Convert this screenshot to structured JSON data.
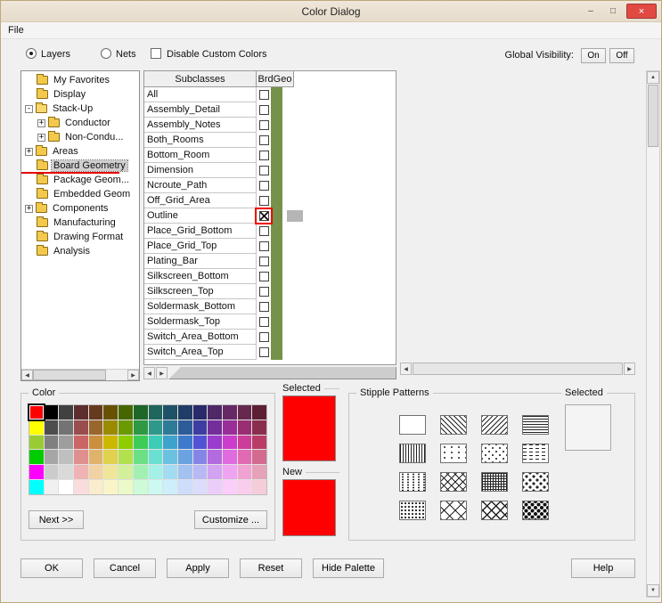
{
  "window": {
    "title": "Color Dialog"
  },
  "icons": {
    "minimize": "–",
    "maximize": "□",
    "close": "×",
    "arrow_up": "▲",
    "arrow_down": "▼",
    "arrow_left": "◀",
    "arrow_right": "▶",
    "expand": "+",
    "collapse": "-"
  },
  "menu": {
    "items": [
      "File"
    ]
  },
  "filter_bar": {
    "layers": "Layers",
    "nets": "Nets",
    "layers_selected": true,
    "disable_custom_colors": "Disable Custom Colors",
    "disable_checked": false,
    "global_visibility_label": "Global Visibility:",
    "on": "On",
    "off": "Off"
  },
  "tree": {
    "items": [
      {
        "label": "My Favorites",
        "level": 0,
        "expander": null
      },
      {
        "label": "Display",
        "level": 0,
        "expander": null
      },
      {
        "label": "Stack-Up",
        "level": 0,
        "expander": "minus",
        "open": true
      },
      {
        "label": "Conductor",
        "level": 1,
        "expander": "plus"
      },
      {
        "label": "Non-Condu...",
        "level": 1,
        "expander": "plus"
      },
      {
        "label": "Areas",
        "level": 0,
        "expander": "plus"
      },
      {
        "label": "Board Geometry",
        "level": 0,
        "expander": null,
        "selected": true,
        "annotated": true
      },
      {
        "label": "Package Geom...",
        "level": 0,
        "expander": null
      },
      {
        "label": "Embedded Geom",
        "level": 0,
        "expander": null
      },
      {
        "label": "Components",
        "level": 0,
        "expander": "plus"
      },
      {
        "label": "Manufacturing",
        "level": 0,
        "expander": null
      },
      {
        "label": "Drawing Format",
        "level": 0,
        "expander": null
      },
      {
        "label": "Analysis",
        "level": 0,
        "expander": null
      }
    ]
  },
  "subclass_table": {
    "headers": [
      "Subclasses",
      "BrdGeo"
    ],
    "layer_color": "#76914a",
    "rows": [
      {
        "label": "All",
        "checked": false
      },
      {
        "label": "Assembly_Detail",
        "checked": false
      },
      {
        "label": "Assembly_Notes",
        "checked": false
      },
      {
        "label": "Both_Rooms",
        "checked": false
      },
      {
        "label": "Bottom_Room",
        "checked": false
      },
      {
        "label": "Dimension",
        "checked": false
      },
      {
        "label": "Ncroute_Path",
        "checked": false
      },
      {
        "label": "Off_Grid_Area",
        "checked": false
      },
      {
        "label": "Outline",
        "checked": true,
        "annotated": true,
        "marker": true
      },
      {
        "label": "Place_Grid_Bottom",
        "checked": false
      },
      {
        "label": "Place_Grid_Top",
        "checked": false
      },
      {
        "label": "Plating_Bar",
        "checked": false
      },
      {
        "label": "Silkscreen_Bottom",
        "checked": false
      },
      {
        "label": "Silkscreen_Top",
        "checked": false
      },
      {
        "label": "Soldermask_Bottom",
        "checked": false
      },
      {
        "label": "Soldermask_Top",
        "checked": false
      },
      {
        "label": "Switch_Area_Bottom",
        "checked": false
      },
      {
        "label": "Switch_Area_Top",
        "checked": false
      }
    ]
  },
  "color_section": {
    "legend": "Color",
    "next_label": "Next >>",
    "customize_label": "Customize ...",
    "selected_index": 0,
    "palette": [
      [
        "#ff0000",
        "#000000",
        "#404040",
        "#5c2e2e",
        "#663a1f",
        "#665200",
        "#466600",
        "#1f6629",
        "#1f665c",
        "#1f5266",
        "#1f3d66",
        "#29296b",
        "#4d2966",
        "#662966",
        "#66294d",
        "#5c1f33"
      ],
      [
        "#ffff00",
        "#4d4d4d",
        "#737373",
        "#994d4d",
        "#99662e",
        "#998a00",
        "#6b9900",
        "#2e9942",
        "#2e998a",
        "#2e7a99",
        "#2e5c99",
        "#3d3da1",
        "#732e99",
        "#992e99",
        "#992e73",
        "#8a2e4d"
      ],
      [
        "#99cc33",
        "#808080",
        "#9e9e9e",
        "#cc6666",
        "#cc8f3d",
        "#ccb800",
        "#8fcc00",
        "#3dcc58",
        "#3dccb8",
        "#3da3cc",
        "#3d7acc",
        "#5252d6",
        "#993dcc",
        "#cc3dcc",
        "#cc3d99",
        "#b83d66"
      ],
      [
        "#00cc00",
        "#a6a6a6",
        "#bfbfbf",
        "#e08f8f",
        "#e0b36b",
        "#e0d24d",
        "#b3e04d",
        "#6be085",
        "#6be0d2",
        "#6bc2e0",
        "#6ba3e0",
        "#8585e8",
        "#b36be0",
        "#e06be0",
        "#e06bb3",
        "#d26b8f"
      ],
      [
        "#ff00ff",
        "#cccccc",
        "#d9d9d9",
        "#f0b3b3",
        "#f0d2a3",
        "#f0e699",
        "#d2f099",
        "#a3f0b3",
        "#a3f0e6",
        "#a3dcf0",
        "#a3c2f0",
        "#b8b8f5",
        "#d2a3f0",
        "#f0a3f0",
        "#f0a3d2",
        "#e6a3b8"
      ],
      [
        "#00ffff",
        "#f0f0f0",
        "#ffffff",
        "#fadcdc",
        "#faeccd",
        "#faf5c8",
        "#ecfac8",
        "#cdfad7",
        "#cdfaf0",
        "#cdeefa",
        "#cdddfa",
        "#dcdcfc",
        "#eccdfa",
        "#facdfa",
        "#facdec",
        "#f5cdd9"
      ]
    ]
  },
  "preview": {
    "selected_label": "Selected",
    "selected_color": "#ff0000",
    "new_label": "New",
    "new_color": "#ff0000"
  },
  "stipple_section": {
    "legend": "Stipple Patterns",
    "selected_label": "Selected",
    "patterns": [
      {
        "name": "solid-blank"
      },
      {
        "name": "diagonal-back"
      },
      {
        "name": "diagonal-forward"
      },
      {
        "name": "horizontal-lines"
      },
      {
        "name": "vertical-lines"
      },
      {
        "name": "dots-dash-sparse"
      },
      {
        "name": "dots-plus"
      },
      {
        "name": "dashed-lines"
      },
      {
        "name": "dotted-columns"
      },
      {
        "name": "diagonal-crosshatch"
      },
      {
        "name": "grid-fine"
      },
      {
        "name": "polka-dots"
      },
      {
        "name": "dots-diagonal-dense"
      },
      {
        "name": "diamond-outline"
      },
      {
        "name": "diamond-crosshatch"
      },
      {
        "name": "dots-heavy"
      }
    ]
  },
  "footer": {
    "buttons": [
      {
        "name": "ok-button",
        "label": "OK"
      },
      {
        "name": "cancel-button",
        "label": "Cancel"
      },
      {
        "name": "apply-button",
        "label": "Apply"
      },
      {
        "name": "reset-button",
        "label": "Reset"
      },
      {
        "name": "hide-palette-button",
        "label": "Hide Palette"
      },
      {
        "name": "help-button",
        "label": "Help"
      }
    ]
  }
}
